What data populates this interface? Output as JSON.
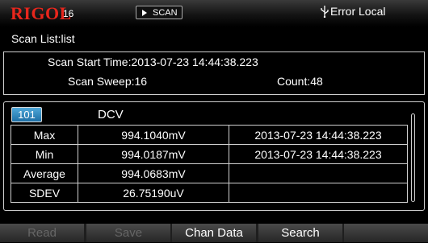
{
  "header": {
    "logo": "RIGOL",
    "model_number": "16",
    "mode": "SCAN",
    "status": "Error Local"
  },
  "title": "Scan List:list",
  "info": {
    "start_time": "Scan Start Time:2013-07-23 14:44:38.223",
    "sweep": "Scan Sweep:16",
    "count": "Count:48"
  },
  "channel": {
    "id": "101",
    "function": "DCV"
  },
  "stats": [
    {
      "label": "Max",
      "value": "994.1040mV",
      "time": "2013-07-23 14:44:38.223"
    },
    {
      "label": "Min",
      "value": "994.0187mV",
      "time": "2013-07-23 14:44:38.223"
    },
    {
      "label": "Average",
      "value": "994.0683mV",
      "time": ""
    },
    {
      "label": "SDEV",
      "value": "26.75190uV",
      "time": ""
    }
  ],
  "softkeys": [
    "Read",
    "Save",
    "Chan Data",
    "Search",
    ""
  ],
  "colors": {
    "logo": "#e8261c",
    "channel_badge": "#2a86c0"
  }
}
